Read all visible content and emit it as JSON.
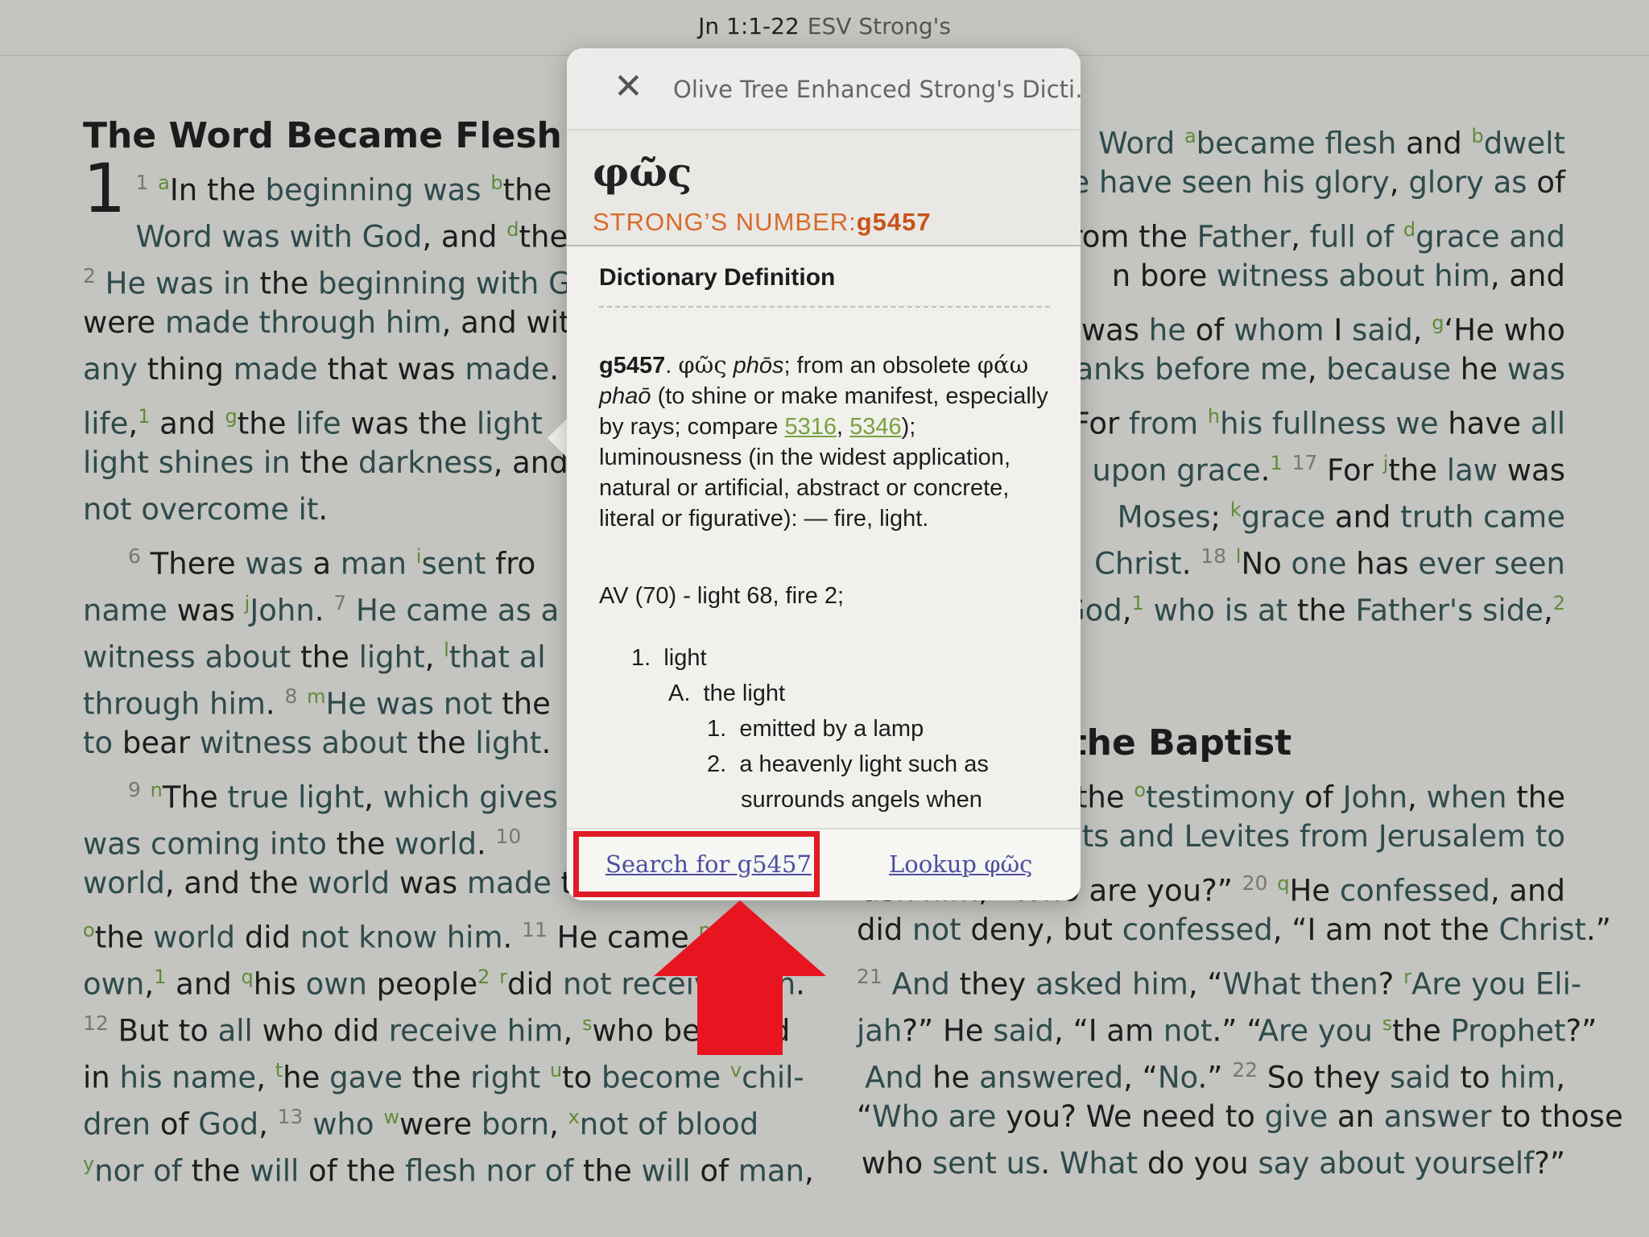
{
  "topbar": {
    "reference": "Jn 1:1-22",
    "version": "ESV Strong's"
  },
  "popup": {
    "title": "Olive Tree Enhanced Strong's Dicti…",
    "word": "φῶς",
    "strongs_label": "STRONG’S NUMBER:",
    "strongs_number": "g5457",
    "section_heading": "Dictionary Definition",
    "def_id": "g5457",
    "def_word": "φῶς",
    "def_translit": "phōs",
    "def_text1": "; from an obsolete",
    "def_root": "φάω",
    "def_root_translit": "phaō",
    "def_text2": " (to shine or make manifest, especially by rays; compare ",
    "link1": "5316",
    "link2": "5346",
    "def_text3": "); luminousness (in the widest application, natural or artificial, abstract or concrete, literal or figurative): — fire, light.",
    "av_line": "AV (70) - light 68, fire 2;",
    "outline": [
      {
        "num": "1.",
        "text": "light"
      },
      {
        "num": "A.",
        "text": "the light"
      },
      {
        "num": "1.",
        "text": "emitted by a lamp"
      },
      {
        "num": "2.",
        "text": "a heavenly light such as"
      },
      {
        "num": "",
        "text": "surrounds angels when"
      }
    ],
    "search_link": "Search for g5457",
    "lookup_link": "Lookup φῶς"
  },
  "bible": {
    "heading_left": "The Word Became Flesh",
    "chapter": "1",
    "heading_right": "ny of John the Baptist"
  },
  "annotation": {
    "box_color": "#e01b24",
    "arrow_color": "#e8141f"
  }
}
